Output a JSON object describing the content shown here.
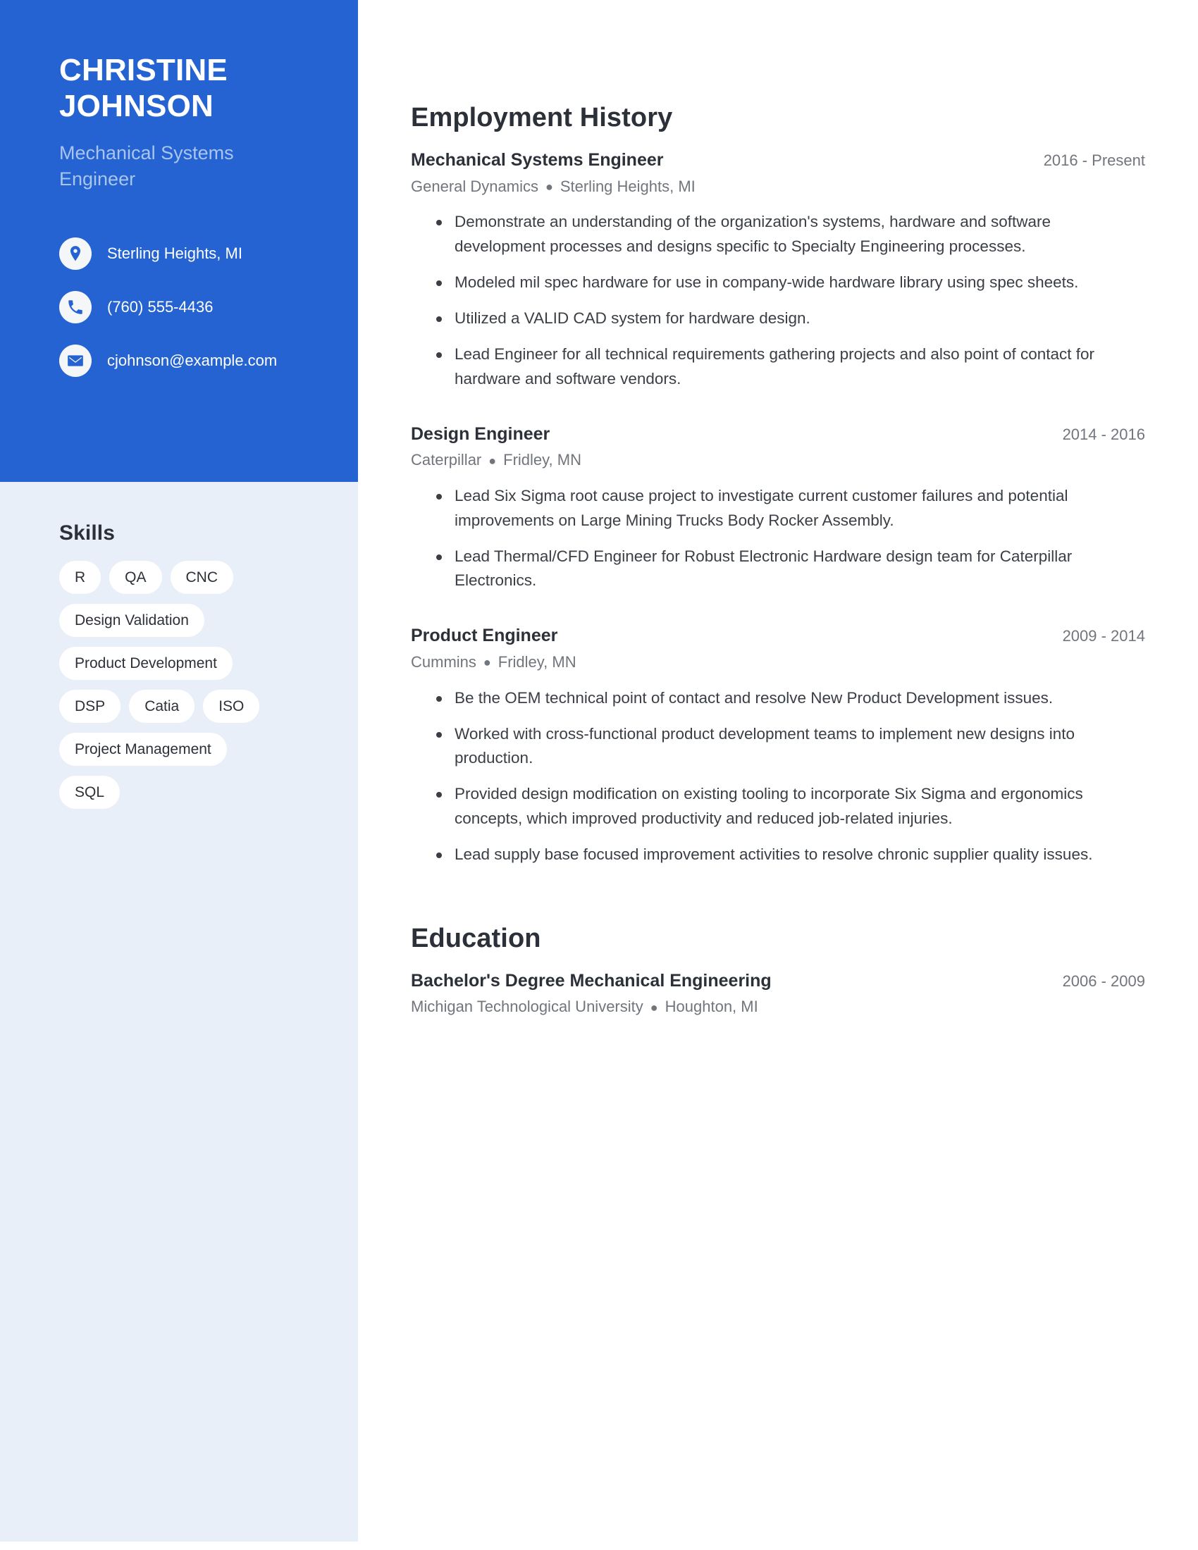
{
  "theme": {
    "primary_blue": "#2463d1",
    "sidebar_bg": "#e8eff9",
    "subtitle_blue": "#a9c5ec",
    "heading_dark": "#2c3038",
    "muted_gray": "#71757c",
    "body_gray": "#3a3e45",
    "pill_bg": "#ffffff"
  },
  "sidebar": {
    "name_lines": [
      "CHRISTINE",
      "JOHNSON"
    ],
    "role_lines": [
      "Mechanical Systems",
      "Engineer"
    ],
    "contacts": [
      {
        "icon": "location-pin-icon",
        "text": "Sterling Heights, MI"
      },
      {
        "icon": "phone-icon",
        "text": "(760) 555-4436"
      },
      {
        "icon": "email-icon",
        "text": "cjohnson@example.com"
      }
    ],
    "skills_title": "Skills",
    "skill_rows": [
      [
        "R",
        "QA",
        "CNC"
      ],
      [
        "Design Validation"
      ],
      [
        "Product Development"
      ],
      [
        "DSP",
        "Catia",
        "ISO"
      ],
      [
        "Project Management"
      ],
      [
        "SQL"
      ]
    ]
  },
  "main": {
    "employment": {
      "title": "Employment History",
      "entries": [
        {
          "job_title": "Mechanical Systems Engineer",
          "dates": "2016 - Present",
          "company": "General Dynamics",
          "separator": "●",
          "location": "Sterling Heights, MI",
          "bullets": [
            "Demonstrate an understanding of the organization's systems, hardware and software development processes and designs specific to Specialty Engineering processes.",
            "Modeled mil spec hardware for use in company-wide hardware library using spec sheets.",
            "Utilized a VALID CAD system for hardware design.",
            "Lead Engineer for all technical requirements gathering projects and also point of contact for hardware and software vendors."
          ]
        },
        {
          "job_title": "Design Engineer",
          "dates": "2014 - 2016",
          "company": "Caterpillar",
          "separator": "●",
          "location": "Fridley, MN",
          "bullets": [
            "Lead Six Sigma root cause project to investigate current customer failures and potential improvements on Large Mining Trucks Body Rocker Assembly.",
            "Lead Thermal/CFD Engineer for Robust Electronic Hardware design team for Caterpillar Electronics."
          ]
        },
        {
          "job_title": "Product Engineer",
          "dates": "2009 - 2014",
          "company": "Cummins",
          "separator": "●",
          "location": "Fridley, MN",
          "bullets": [
            "Be the OEM technical point of contact and resolve New Product Development issues.",
            "Worked with cross-functional product development teams to implement new designs into production.",
            "Provided design modification on existing tooling to incorporate Six Sigma and ergonomics concepts, which improved productivity and reduced job-related injuries.",
            "Lead supply base focused improvement activities to resolve chronic supplier quality issues."
          ]
        }
      ]
    },
    "education": {
      "title": "Education",
      "entries": [
        {
          "degree": "Bachelor's Degree Mechanical Engineering",
          "dates": "2006 - 2009",
          "school": "Michigan Technological University",
          "separator": "●",
          "location": "Houghton, MI"
        }
      ]
    }
  }
}
